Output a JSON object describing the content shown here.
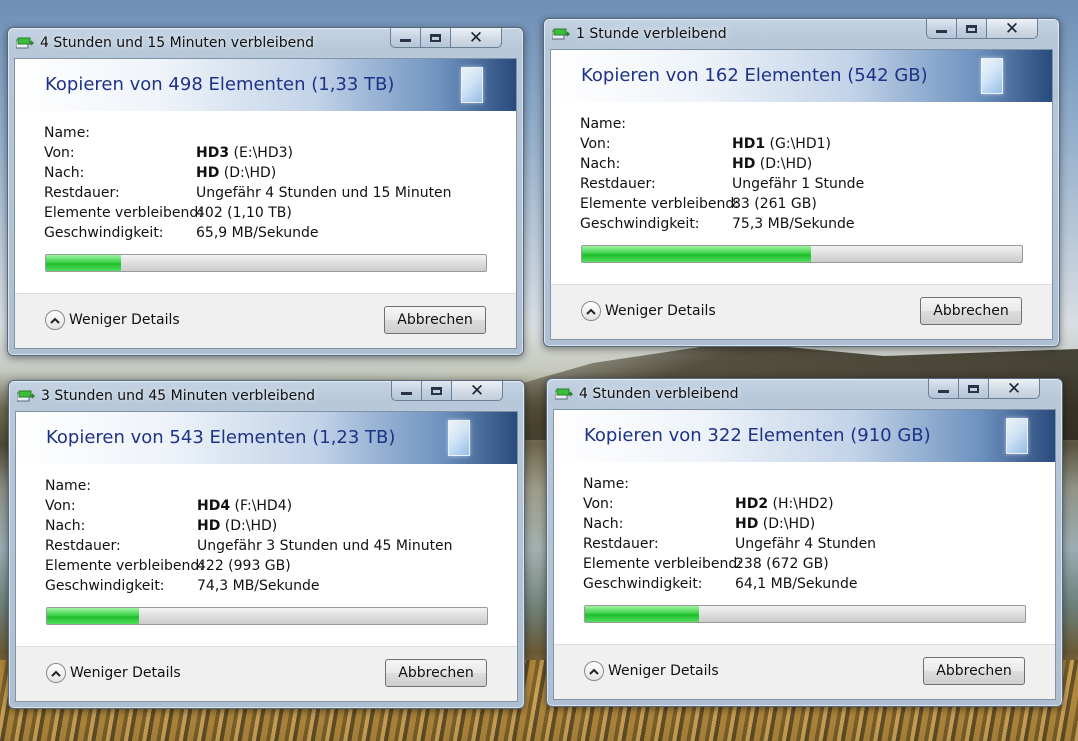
{
  "labels": {
    "name": "Name:",
    "from": "Von:",
    "to": "Nach:",
    "remaining_time": "Restdauer:",
    "items_remaining": "Elemente verbleibend:",
    "speed": "Geschwindigkeit:",
    "less_details": "Weniger Details",
    "cancel": "Abbrechen"
  },
  "dialogs": [
    {
      "title": "4 Stunden und 15 Minuten verbleibend",
      "heading": "Kopieren von 498 Elementen (1,33 TB)",
      "name": "",
      "from_bold": "HD3",
      "from_path": "(E:\\HD3)",
      "to_bold": "HD",
      "to_path": "(D:\\HD)",
      "remaining": "Ungefähr 4 Stunden und 15 Minuten",
      "items": "402 (1,10 TB)",
      "speed": "65,9 MB/Sekunde",
      "progress": 0.17
    },
    {
      "title": "1 Stunde verbleibend",
      "heading": "Kopieren von 162 Elementen (542 GB)",
      "name": "",
      "from_bold": "HD1",
      "from_path": "(G:\\HD1)",
      "to_bold": "HD",
      "to_path": "(D:\\HD)",
      "remaining": "Ungefähr 1 Stunde",
      "items": "83 (261 GB)",
      "speed": "75,3 MB/Sekunde",
      "progress": 0.52
    },
    {
      "title": "3 Stunden und 45 Minuten verbleibend",
      "heading": "Kopieren von 543 Elementen (1,23 TB)",
      "name": "",
      "from_bold": "HD4",
      "from_path": "(F:\\HD4)",
      "to_bold": "HD",
      "to_path": "(D:\\HD)",
      "remaining": "Ungefähr 3 Stunden und 45 Minuten",
      "items": "422 (993 GB)",
      "speed": "74,3 MB/Sekunde",
      "progress": 0.21
    },
    {
      "title": "4 Stunden verbleibend",
      "heading": "Kopieren von 322 Elementen (910 GB)",
      "name": "",
      "from_bold": "HD2",
      "from_path": "(H:\\HD2)",
      "to_bold": "HD",
      "to_path": "(D:\\HD)",
      "remaining": "Ungefähr 4 Stunden",
      "items": "238 (672 GB)",
      "speed": "64,1 MB/Sekunde",
      "progress": 0.26
    }
  ]
}
